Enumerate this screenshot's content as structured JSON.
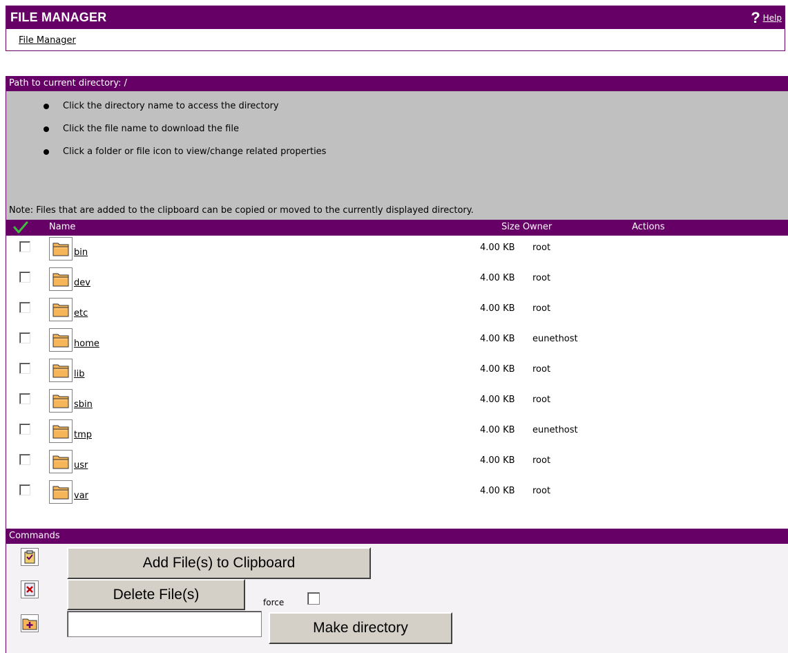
{
  "header": {
    "title": "FILE MANAGER",
    "help_icon": "?",
    "help_label": "Help",
    "breadcrumb": "File Manager",
    "accent_color": "#660066"
  },
  "path": {
    "label": "Path to current directory: /"
  },
  "info": {
    "items": [
      "Click the directory name to access the directory",
      "Click the file name to download the file",
      "Click a folder or file icon to view/change related properties"
    ],
    "note": "Note: Files that are added to the clipboard can be copied or moved to the currently displayed directory."
  },
  "columns": {
    "name": "Name",
    "size_owner": "Size Owner",
    "actions": "Actions"
  },
  "files": [
    {
      "name": "bin",
      "size": "4.00 KB",
      "owner": "root",
      "icon": "folder-icon"
    },
    {
      "name": "dev",
      "size": "4.00 KB",
      "owner": "root",
      "icon": "folder-icon"
    },
    {
      "name": "etc",
      "size": "4.00 KB",
      "owner": "root",
      "icon": "folder-icon"
    },
    {
      "name": "home",
      "size": "4.00 KB",
      "owner": "eunethost",
      "icon": "folder-icon"
    },
    {
      "name": "lib",
      "size": "4.00 KB",
      "owner": "root",
      "icon": "folder-icon"
    },
    {
      "name": "sbin",
      "size": "4.00 KB",
      "owner": "root",
      "icon": "folder-icon"
    },
    {
      "name": "tmp",
      "size": "4.00 KB",
      "owner": "eunethost",
      "icon": "folder-icon"
    },
    {
      "name": "usr",
      "size": "4.00 KB",
      "owner": "root",
      "icon": "folder-icon"
    },
    {
      "name": "var",
      "size": "4.00 KB",
      "owner": "root",
      "icon": "folder-icon"
    }
  ],
  "commands": {
    "label": "Commands",
    "add_clipboard": "Add File(s) to Clipboard",
    "delete": "Delete File(s)",
    "force_label": "force",
    "make_dir": "Make directory",
    "dir_input_value": ""
  }
}
